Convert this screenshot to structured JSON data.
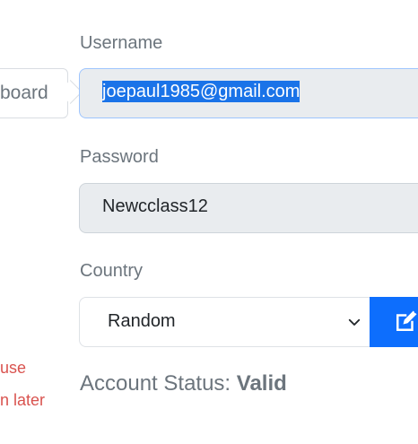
{
  "left_panel": {
    "chip_text": "board",
    "note_line_1": "use",
    "note_line_2": "n later"
  },
  "form": {
    "username_label": "Username",
    "username_value": "joepaul1985@gmail.com",
    "password_label": "Password",
    "password_value": "Newcclass12",
    "country_label": "Country",
    "country_selected": "Random",
    "edit_icon": "edit-pencil-icon",
    "account_status_label": "Account Status:",
    "account_status_value": "Valid"
  },
  "colors": {
    "primary": "#0d6efd",
    "selection": "#1a73e8",
    "error": "#d9534f",
    "muted": "#6c757d"
  }
}
